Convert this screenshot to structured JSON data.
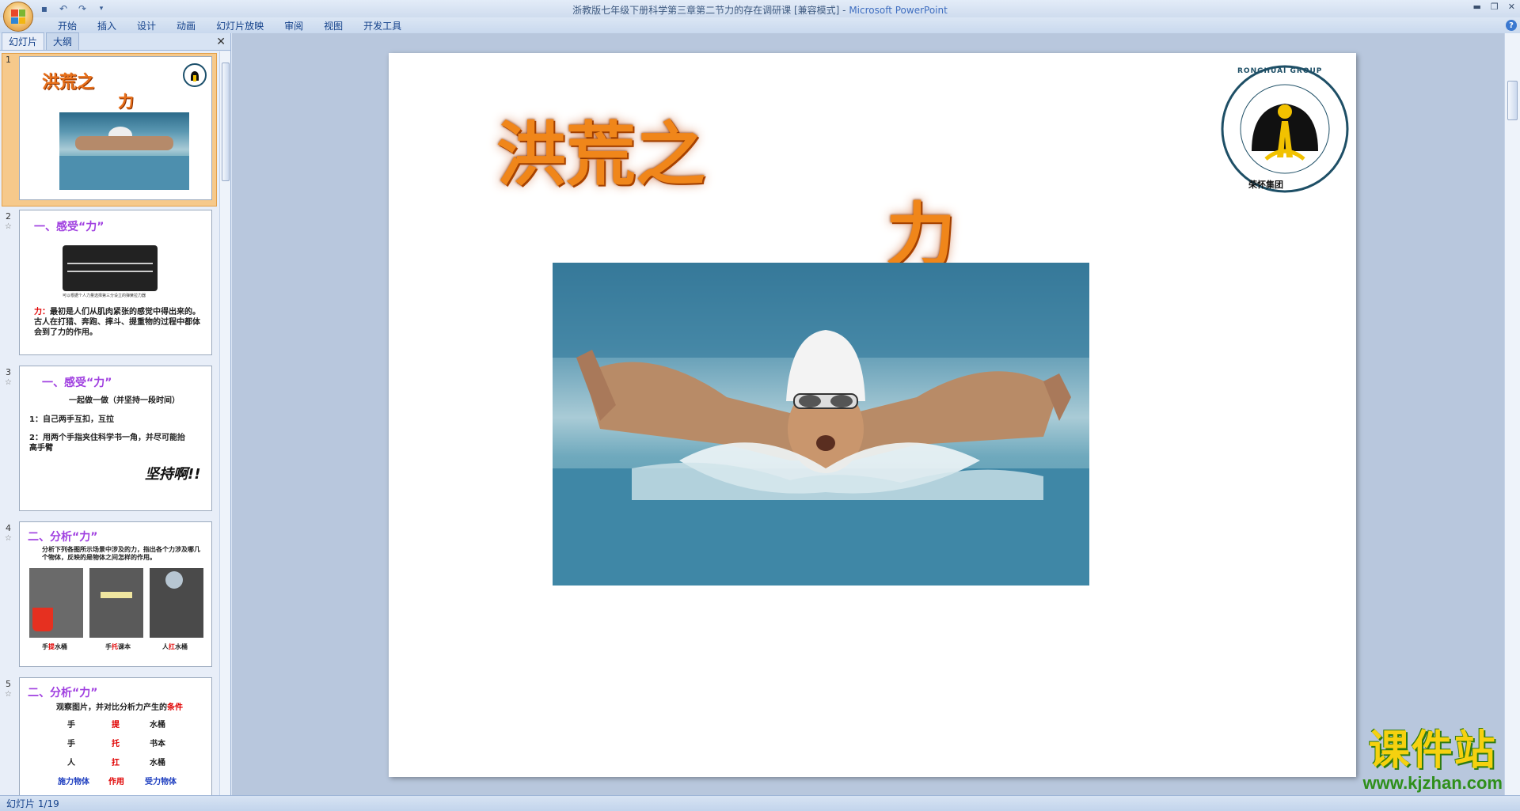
{
  "window": {
    "title": "浙教版七年级下册科学第三章第二节力的存在调研课 [兼容模式]",
    "app_name": "Microsoft PowerPoint",
    "separator": " - "
  },
  "ribbon": {
    "tabs": [
      "开始",
      "插入",
      "设计",
      "动画",
      "幻灯片放映",
      "审阅",
      "视图",
      "开发工具"
    ]
  },
  "left_pane": {
    "tabs": [
      "幻灯片",
      "大纲"
    ],
    "close": "✕",
    "slides": [
      {
        "num": "1",
        "title": "洪荒之",
        "title2": "力"
      },
      {
        "num": "2",
        "heading": "一、感受“力”",
        "caption": "可以根据个人力量选择第三分设立的弹簧拉力器",
        "label": "力：",
        "text": "最初是人们从肌肉紧张的感觉中得出来的。古人在打猎、奔跑、摔斗、提重物的过程中都体会到了力的作用。"
      },
      {
        "num": "3",
        "heading": "一、感受“力”",
        "sub": "一起做一做（并坚持一段时间）",
        "item1": "1：自己两手互扣，互拉",
        "item2": "2：用两个手指夹住科学书一角，并尽可能抬高手臂",
        "shout": "坚持啊!!"
      },
      {
        "num": "4",
        "heading": "二、分析“力”",
        "text": "分析下列各图所示场景中涉及的力，指出各个力涉及哪几个物体，反映的是物体之间怎样的作用。",
        "cap1a": "手",
        "cap1b": "提",
        "cap1c": "水桶",
        "cap2a": "手",
        "cap2b": "托",
        "cap2c": "课本",
        "cap3a": "人",
        "cap3b": "扛",
        "cap3c": "水桶"
      },
      {
        "num": "5",
        "heading": "二、分析“力”",
        "text_a": "观察图片，并对比分析力产生的",
        "text_b": "条件",
        "rows": [
          [
            "手",
            "提",
            "水桶"
          ],
          [
            "手",
            "托",
            "书本"
          ],
          [
            "人",
            "扛",
            "水桶"
          ]
        ],
        "footer_a": "施力物体",
        "footer_b": "作用",
        "footer_c": "受力物体"
      }
    ]
  },
  "slide": {
    "title_line1": "洪荒之",
    "title_line2": "力",
    "logo_text": "RONGHUAI GROUP",
    "logo_cn": "荣怀集团"
  },
  "status": {
    "text": "幻灯片 1/19"
  },
  "watermark": {
    "cn": "课件站",
    "url": "www.kjzhan.com"
  },
  "colors": {
    "title_orange": "#f0861a",
    "heading_purple": "#a040e0",
    "accent_red": "#e00000"
  }
}
